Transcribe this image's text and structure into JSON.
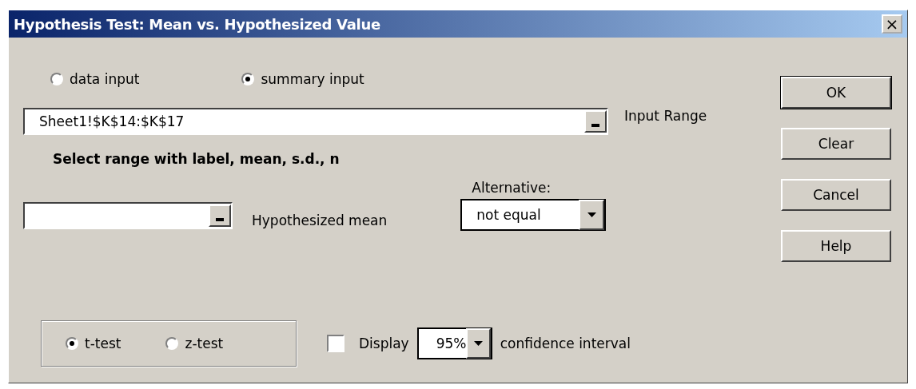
{
  "window": {
    "title": "Hypothesis Test: Mean vs. Hypothesized Value",
    "close": "×"
  },
  "input_mode": [
    {
      "label": "data input",
      "selected": false
    },
    {
      "label": "summary input",
      "selected": true
    }
  ],
  "input_range": {
    "value": "Sheet1!$K$14:$K$17",
    "label": "Input Range"
  },
  "hint": "Select range with label, mean, s.d., n",
  "hypothesized_mean": {
    "label": "Hypothesized mean"
  },
  "alternative": {
    "label": "Alternative:",
    "value": "not equal"
  },
  "test_type": [
    {
      "label": "t-test",
      "selected": true
    },
    {
      "label": "z-test",
      "selected": false
    }
  ],
  "confidence": {
    "checked": false,
    "label": "Display",
    "value": "95%",
    "suffix": "confidence interval"
  },
  "buttons": [
    {
      "label": "OK",
      "default": true
    },
    {
      "label": "Clear",
      "default": false
    },
    {
      "label": "Cancel",
      "default": false
    },
    {
      "label": "Help",
      "default": false
    }
  ]
}
